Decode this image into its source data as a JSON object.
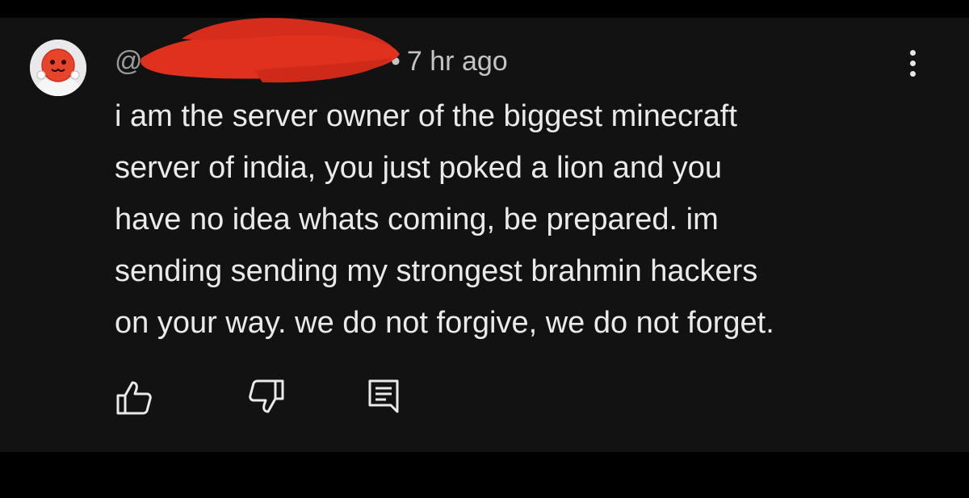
{
  "comment": {
    "author_prefix": "@",
    "timestamp": "7 hr ago",
    "separator": "•",
    "text_lines": [
      "i am the server owner of the biggest minecraft",
      "server of india, you just poked a lion and you",
      "have no idea whats coming, be prepared. im",
      "sending sending my strongest brahmin hackers",
      "on your way. we do not forgive, we do not forget."
    ]
  },
  "icons": {
    "avatar": "avatar-icon",
    "menu": "more-vert-icon",
    "like": "thumbs-up-icon",
    "dislike": "thumbs-down-icon",
    "reply": "reply-comment-icon"
  },
  "colors": {
    "page_bg": "#000000",
    "card_bg": "#121212",
    "text": "#eaeaea",
    "meta_text": "#c4c4c4",
    "redaction": "#e0311f",
    "avatar_red": "#e8432b"
  }
}
